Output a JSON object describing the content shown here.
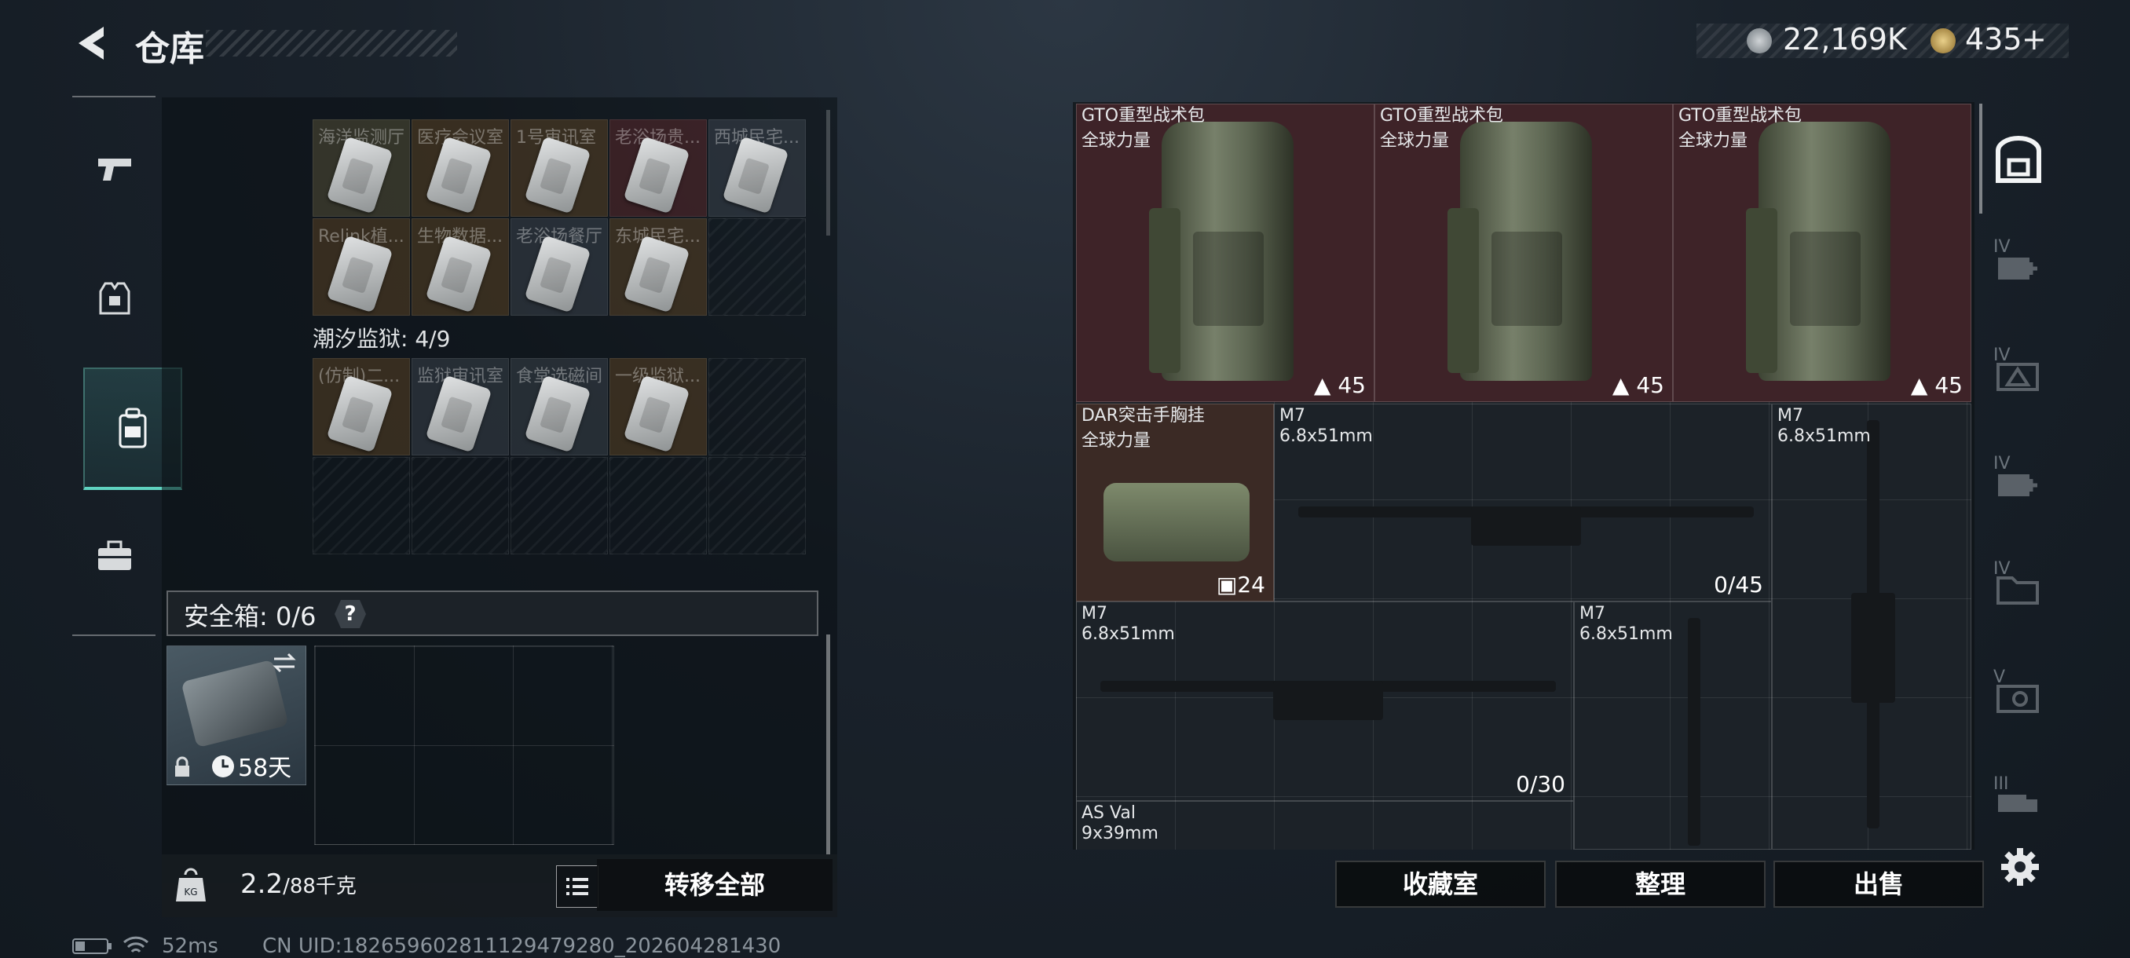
{
  "header": {
    "title": "仓库",
    "currency_1": "22,169K",
    "currency_2": "435",
    "currency_2_plus": "+"
  },
  "status_bar": {
    "ping": "52ms",
    "uid": "CN UID:1826596028111294792​80_202604281430"
  },
  "left_tabs": [
    {
      "icon": "pistol-icon"
    },
    {
      "icon": "armor-vest-icon"
    },
    {
      "icon": "backpack-icon",
      "active": true
    },
    {
      "icon": "toolbox-icon"
    }
  ],
  "keycards": {
    "group1_rows": [
      [
        "海洋监测厅",
        "医疗会议室",
        "1号审讯室",
        "老浴场贵...",
        "西城民宅..."
      ],
      [
        "Relink植...",
        "生物数据...",
        "老浴场餐厅",
        "东城民宅..."
      ]
    ],
    "group2_label": "潮汐监狱: 4/9",
    "group2_rows": [
      [
        "(仿制)二...",
        "监狱审讯室",
        "食堂选磁间",
        "一级监狱..."
      ]
    ]
  },
  "safebox": {
    "label": "安全箱: 0/6",
    "help": "?",
    "days": "58天"
  },
  "bottom": {
    "weight_current": "2.2",
    "weight_max": "/88千克",
    "transfer_all": "转移全部"
  },
  "items": {
    "bags": [
      {
        "name": "GTO重型战术包",
        "sub": "全球力量",
        "count": "45"
      },
      {
        "name": "GTO重型战术包",
        "sub": "全球力量",
        "count": "45"
      },
      {
        "name": "GTO重型战术包",
        "sub": "全球力量",
        "count": "45"
      }
    ],
    "rig": {
      "name": "DAR突击手胸挂",
      "sub": "全球力量",
      "count": "24"
    },
    "guns": [
      {
        "name": "M7",
        "sub": "6.8x51mm",
        "ammo": "0/45"
      },
      {
        "name": "M7",
        "sub": "6.8x51mm",
        "ammo": ""
      },
      {
        "name": "M7",
        "sub": "6.8x51mm",
        "ammo": "0/30"
      },
      {
        "name": "M7",
        "sub": "6.8x51mm",
        "ammo": ""
      },
      {
        "name": "AS Val",
        "sub": "9x39mm",
        "ammo": ""
      }
    ]
  },
  "actions": {
    "collection": "收藏室",
    "organize": "整理",
    "sell": "出售"
  },
  "right_tabs": [
    "archive-icon",
    "medkit-plus-icon",
    "triangle-supply-icon",
    "medkit-plus-icon",
    "folder-supply-icon",
    "gear-supply-icon",
    "truck-supply-icon",
    "settings-icon"
  ],
  "right_tab_labels": [
    "IV",
    "IV",
    "IV",
    "IV",
    "V",
    "III"
  ]
}
